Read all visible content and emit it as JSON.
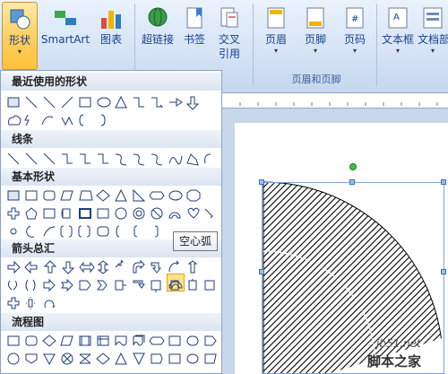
{
  "ribbon": {
    "shapes_label": "形状",
    "smartart_label": "SmartArt",
    "chart_label": "图表",
    "hyperlink_label": "超链接",
    "bookmark_label": "书签",
    "crossref_label_1": "交叉",
    "crossref_label_2": "引用",
    "header_label": "页眉",
    "footer_label": "页脚",
    "pagenum_label": "页码",
    "header_footer_group": "页眉和页脚",
    "textbox_label": "文本框",
    "docparts_label": "文档部"
  },
  "shapes_panel": {
    "recent_title": "最近使用的形状",
    "lines_title": "线条",
    "basic_title": "基本形状",
    "arrows_title": "箭头总汇",
    "flowchart_title": "流程图",
    "tooltip": "空心弧"
  },
  "watermark": {
    "site": "jb51.net",
    "name": "脚本之家"
  },
  "colors": {
    "ribbon_text": "#15428b",
    "highlight": "#ffe38a",
    "shape_fill": "#000000"
  }
}
